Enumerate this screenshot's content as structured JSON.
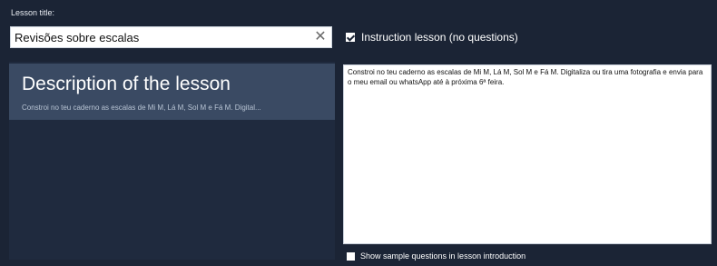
{
  "lesson_title_label": "Lesson title:",
  "title_input": {
    "value": "Revisões sobre escalas",
    "clear_glyph": "✕"
  },
  "instruction_lesson": {
    "checked": true,
    "label": "Instruction lesson (no questions)"
  },
  "description_item": {
    "title": "Description of the lesson",
    "preview": "Constroi no teu caderno as escalas de Mi M, Lá M, Sol M e Fá M. Digital..."
  },
  "description_text": "Constroi no teu caderno as escalas de Mi M, Lá M, Sol M e Fá M. Digitaliza ou tira uma fotografia e envia para o meu email ou whatsApp até à próxima 6ª feira.",
  "show_sample": {
    "checked": false,
    "label": "Show sample questions in lesson introduction"
  },
  "icons": {
    "clear": "close-icon",
    "check": "checkbox-icon"
  },
  "colors": {
    "background": "#1b2435",
    "panel": "#1f2a3e",
    "selected_item": "#3a4a63"
  }
}
